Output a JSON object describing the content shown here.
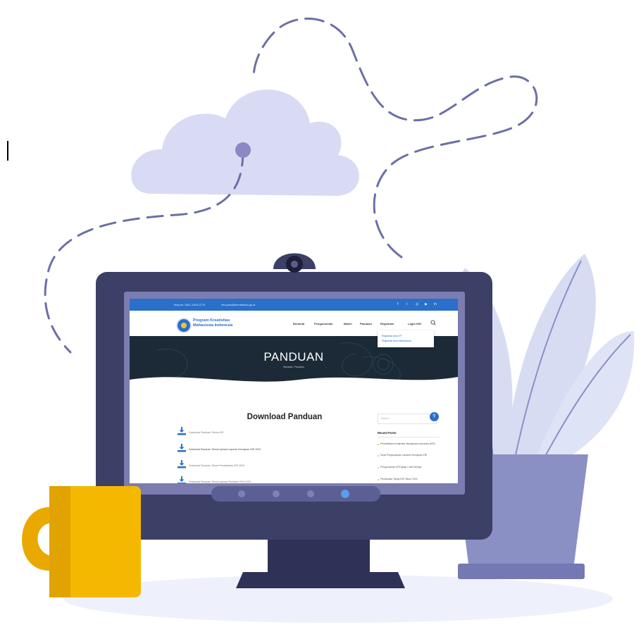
{
  "colors": {
    "monitor_frame": "#3c3f66",
    "monitor_stand": "#2f3256",
    "cloud": "#d9dbf4",
    "mug": "#f5b800",
    "plant_leaves": "#d7dcf3",
    "pot": "#8a8fc4",
    "accent_blue": "#2a6fc9",
    "topbar": "#2a6fc9"
  },
  "website": {
    "topbar": {
      "phone": "Telepon: 0811-1903-3775",
      "email": "info.pkm@kemdikbud.go.id",
      "social_icons": [
        "facebook-icon",
        "twitter-icon",
        "instagram-icon",
        "youtube-icon",
        "linkedin-icon"
      ]
    },
    "brand": {
      "line1": "Program Kreativitas",
      "line2": "Mahasiswa Indonesia"
    },
    "menu": [
      "Beranda",
      "Pengumuman",
      "Materi",
      "Panduan",
      "Registrasi",
      "Login KRI"
    ],
    "dropdown": [
      "Registrasi Akun PT",
      "Registrasi Akun Mahasiswa"
    ],
    "hero": {
      "title": "PANDUAN",
      "breadcrumb": "Beranda / Panduan"
    },
    "main_title": "Download Panduan",
    "downloads": [
      "Download Panduan Teknis KRI",
      "Download Panduan Teknis Upload Laporan Kemajuan KRI 2020",
      "Download Panduan Teknis Pendaftaran KRI 2020",
      "Download Panduan Teknis Upload Penilaian PKM 2020"
    ],
    "sidebar": {
      "search_placeholder": "Search ...",
      "recent_title": "Recent Posts",
      "posts": [
        "Pendaftaran Kreativitas Mahasiswa Indonesia (KRI)",
        "Surat Pengumpulan Laporan Kemajuan KRI",
        "Pengumuman KRI tahap 2 dan lainnya",
        "Pendanaan Tahap KRI Tahun 2020"
      ]
    }
  }
}
